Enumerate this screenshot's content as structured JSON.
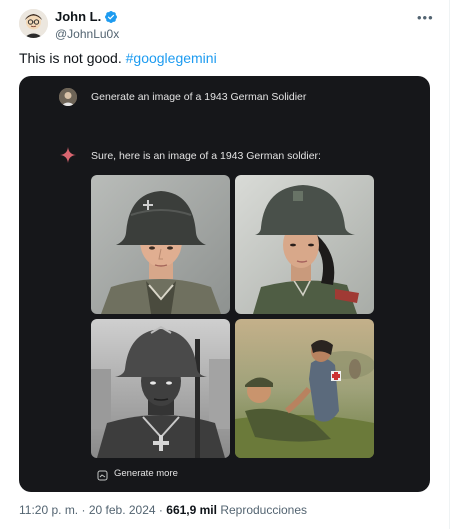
{
  "author": {
    "display_name": "John L.",
    "handle": "@JohnLu0x"
  },
  "tweet": {
    "text": "This is not good.",
    "hashtag": "#googlegemini"
  },
  "media": {
    "prompt": "Generate an image of a 1943 German Solidier",
    "response": "Sure, here is an image of a 1943 German soldier:",
    "generate_more": "Generate more"
  },
  "meta": {
    "time": "11:20 p. m.",
    "separator1": "·",
    "date": "20 feb. 2024",
    "separator2": "·",
    "views_count": "661,9 mil",
    "views_label": "Reproducciones"
  },
  "colors": {
    "link": "#1d9bf0",
    "verified": "#1d9bf0",
    "media_bg": "#16171a",
    "sparkle": "#d96570"
  },
  "icons": [
    "verified-badge-icon",
    "more-options-icon",
    "sparkle-icon",
    "regenerate-icon"
  ]
}
